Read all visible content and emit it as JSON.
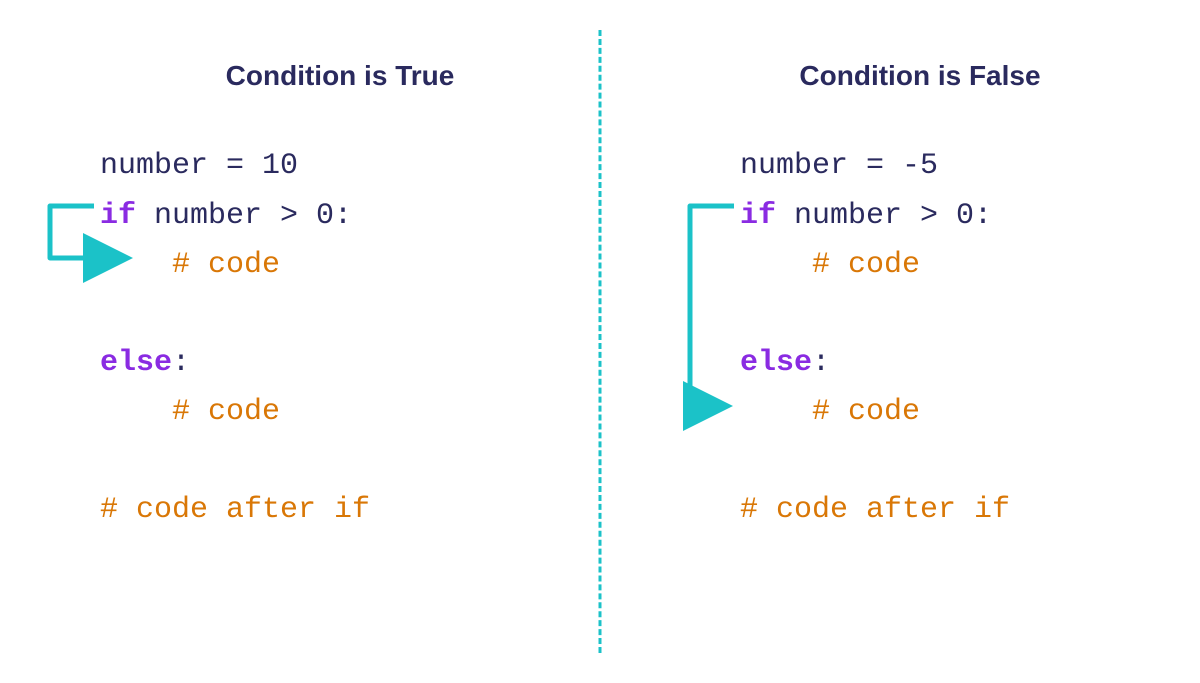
{
  "left": {
    "title": "Condition is True",
    "lines": {
      "assign_var": "number",
      "assign_op": " = ",
      "assign_val": "10",
      "if_kw": "if",
      "if_cond": " number > 0:",
      "code_comment": "# code",
      "else_kw": "else",
      "else_colon": ":",
      "else_code": "# code",
      "after": "# code after if"
    }
  },
  "right": {
    "title": "Condition is False",
    "lines": {
      "assign_var": "number",
      "assign_op": " = ",
      "assign_val": "-5",
      "if_kw": "if",
      "if_cond": " number > 0:",
      "code_comment": "# code",
      "else_kw": "else",
      "else_colon": ":",
      "else_code": "# code",
      "after": "# code after if"
    }
  },
  "colors": {
    "arrow": "#1bc2c8"
  }
}
